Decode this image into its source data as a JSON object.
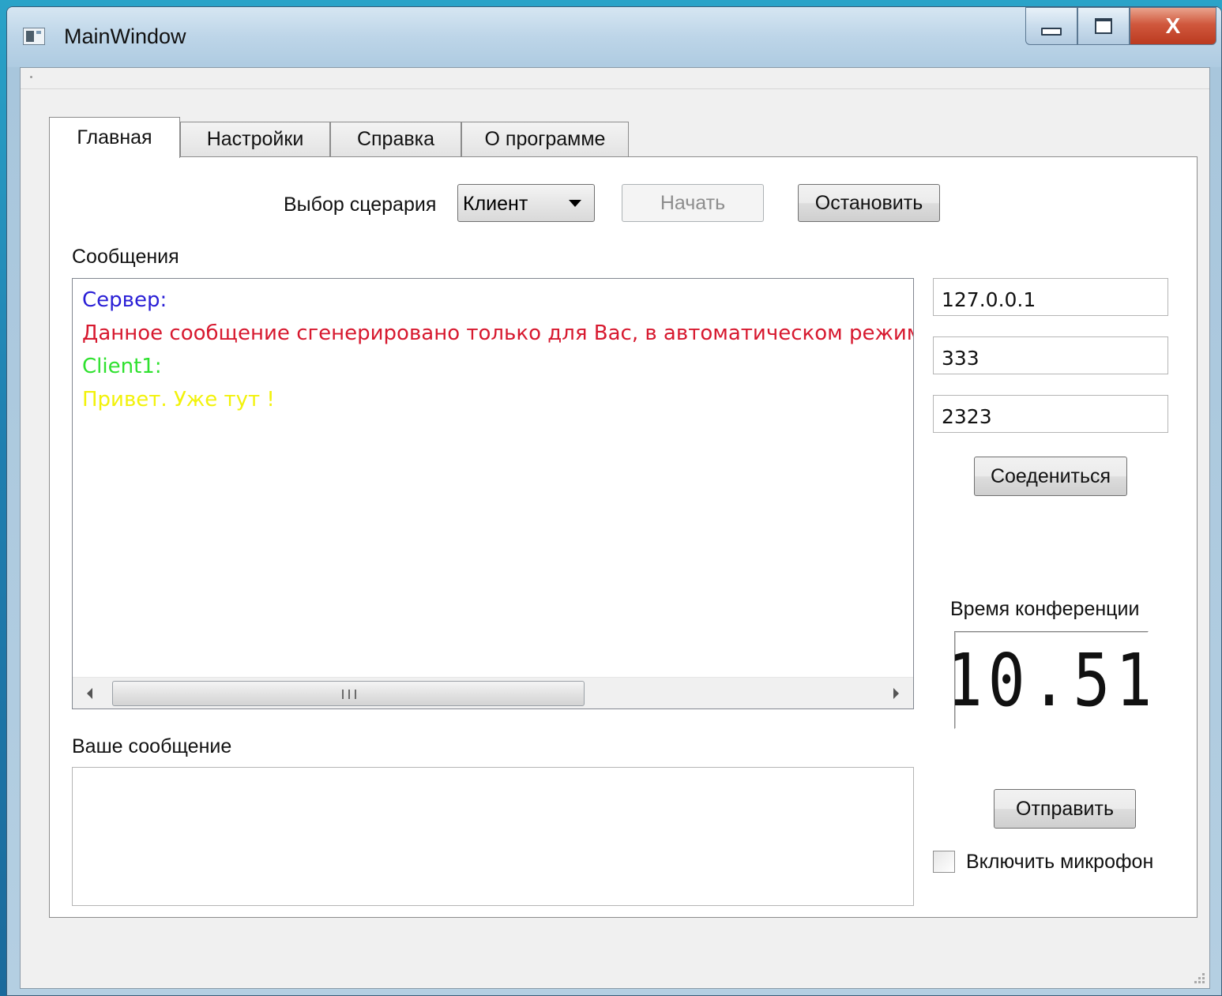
{
  "window": {
    "title": "MainWindow",
    "controls": [
      "minimize-icon",
      "maximize-icon",
      "close-icon"
    ],
    "close_glyph": "X"
  },
  "tabs": [
    {
      "label": "Главная",
      "active": true
    },
    {
      "label": "Настройки",
      "active": false
    },
    {
      "label": "Справка",
      "active": false
    },
    {
      "label": "О программе",
      "active": false
    }
  ],
  "scenario": {
    "label": "Выбор сцерария",
    "selected": "Клиент",
    "start_button": "Начать",
    "start_enabled": false,
    "stop_button": "Остановить"
  },
  "messages": {
    "label": "Сообщения",
    "lines": [
      {
        "text": "Сервер:",
        "color": "#2a1fd6"
      },
      {
        "text": "Данное сообщение сгенерировано только для Вас, в автоматическом режим",
        "color": "#d7192f"
      },
      {
        "text": "Client1:",
        "color": "#2fe12f"
      },
      {
        "text": "Привет. Уже тут !",
        "color": "#f2f20a"
      }
    ]
  },
  "connection": {
    "ip": "127.0.0.1",
    "field2": "333",
    "field3": "2323",
    "connect_button": "Соедениться"
  },
  "conference": {
    "label": "Время конференции",
    "time": "10.51"
  },
  "compose": {
    "label": "Ваше сообщение",
    "value": "",
    "send_button": "Отправить",
    "mic_label": "Включить микрофон",
    "mic_checked": false
  }
}
